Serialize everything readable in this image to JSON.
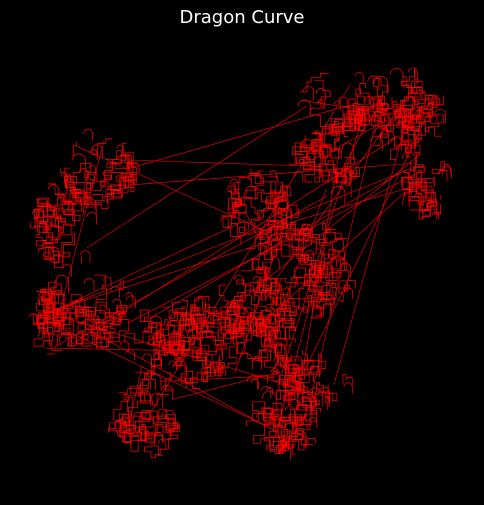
{
  "figure": {
    "title": "Dragon Curve",
    "background": "#000000",
    "line_color": "#ff0000"
  }
}
